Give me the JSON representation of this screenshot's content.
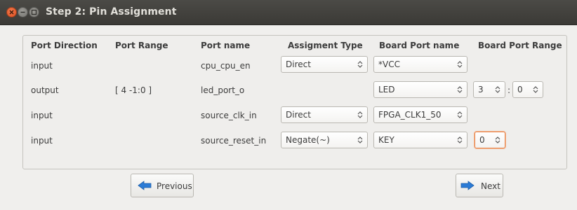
{
  "window": {
    "title": "Step 2: Pin Assignment"
  },
  "table": {
    "headers": {
      "direction": "Port Direction",
      "range": "Port Range",
      "name": "Port name",
      "assign_type": "Assigment Type",
      "board_port": "Board Port name",
      "board_range": "Board Port Range"
    },
    "rows": [
      {
        "direction": "input",
        "range": "",
        "name": "cpu_cpu_en",
        "assign_type": "Direct",
        "board_port": "*VCC"
      },
      {
        "direction": "output",
        "range": "[ 4 -1:0 ]",
        "name": "led_port_o",
        "board_port": "LED",
        "board_range_hi": "3",
        "board_range_sep": ":",
        "board_range_lo": "0"
      },
      {
        "direction": "input",
        "range": "",
        "name": "source_clk_in",
        "assign_type": "Direct",
        "board_port": "FPGA_CLK1_50"
      },
      {
        "direction": "input",
        "range": "",
        "name": "source_reset_in",
        "assign_type": "Negate(~)",
        "board_port": "KEY",
        "board_range_hi": "0"
      }
    ]
  },
  "buttons": {
    "previous": "Previous",
    "next": "Next"
  },
  "colors": {
    "titlebar": "#3b3a36",
    "close": "#d9481a",
    "focus": "#e8874f",
    "arrow_icon": "#2b7bd6"
  },
  "icons": {
    "close": "close-icon",
    "minimize": "minimize-icon",
    "maximize": "maximize-icon",
    "previous": "arrow-left-icon",
    "next": "arrow-right-icon",
    "spinner": "updown-arrows-icon"
  }
}
